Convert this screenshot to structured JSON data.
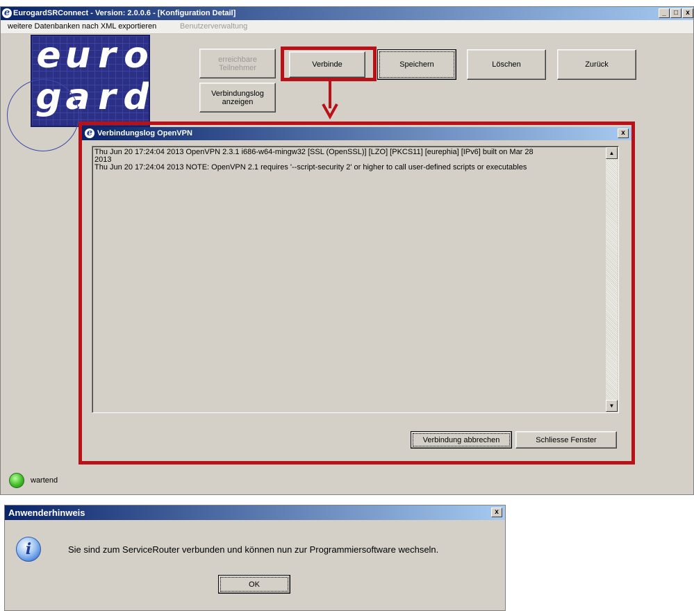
{
  "main_window": {
    "title": "EurogardSRConnect - Version: 2.0.0.6 - [Konfiguration Detail]",
    "controls": [
      "_",
      "□",
      "x"
    ]
  },
  "menu": {
    "export": "weitere Datenbanken nach XML exportieren",
    "users": "Benutzerverwaltung"
  },
  "logo": {
    "letters_top": [
      "e",
      "u",
      "r",
      "o"
    ],
    "letters_bottom": [
      "g",
      "a",
      "r",
      "d"
    ]
  },
  "toolbar": {
    "reachable_line1": "erreichbare",
    "reachable_line2": "Teilnehmer",
    "connect": "Verbinde",
    "save": "Speichern",
    "delete": "Löschen",
    "back": "Zurück",
    "show_log_line1": "Verbindungslog",
    "show_log_line2": "anzeigen"
  },
  "log_dialog": {
    "title": "Verbindungslog OpenVPN",
    "close": "x",
    "log_text": "Thu Jun 20 17:24:04 2013 OpenVPN 2.3.1 i686-w64-mingw32 [SSL (OpenSSL)] [LZO] [PKCS11] [eurephia] [IPv6] built on Mar 28\n2013\nThu Jun 20 17:24:04 2013 NOTE: OpenVPN 2.1 requires '--script-security 2' or higher to call user-defined scripts or executables",
    "cancel_button": "Verbindung abbrechen",
    "close_button": "Schliesse Fenster"
  },
  "status": {
    "text": "wartend",
    "led_color": "#3fbf2a"
  },
  "notice_dialog": {
    "title": "Anwenderhinweis",
    "close": "x",
    "message": "Sie sind zum ServiceRouter verbunden und können nun zur Programmiersoftware wechseln.",
    "ok": "OK"
  },
  "colors": {
    "highlight_red": "#b81218",
    "titlebar_start": "#0a246a",
    "titlebar_end": "#a6caf0",
    "logo_blue": "#2b2f86"
  }
}
